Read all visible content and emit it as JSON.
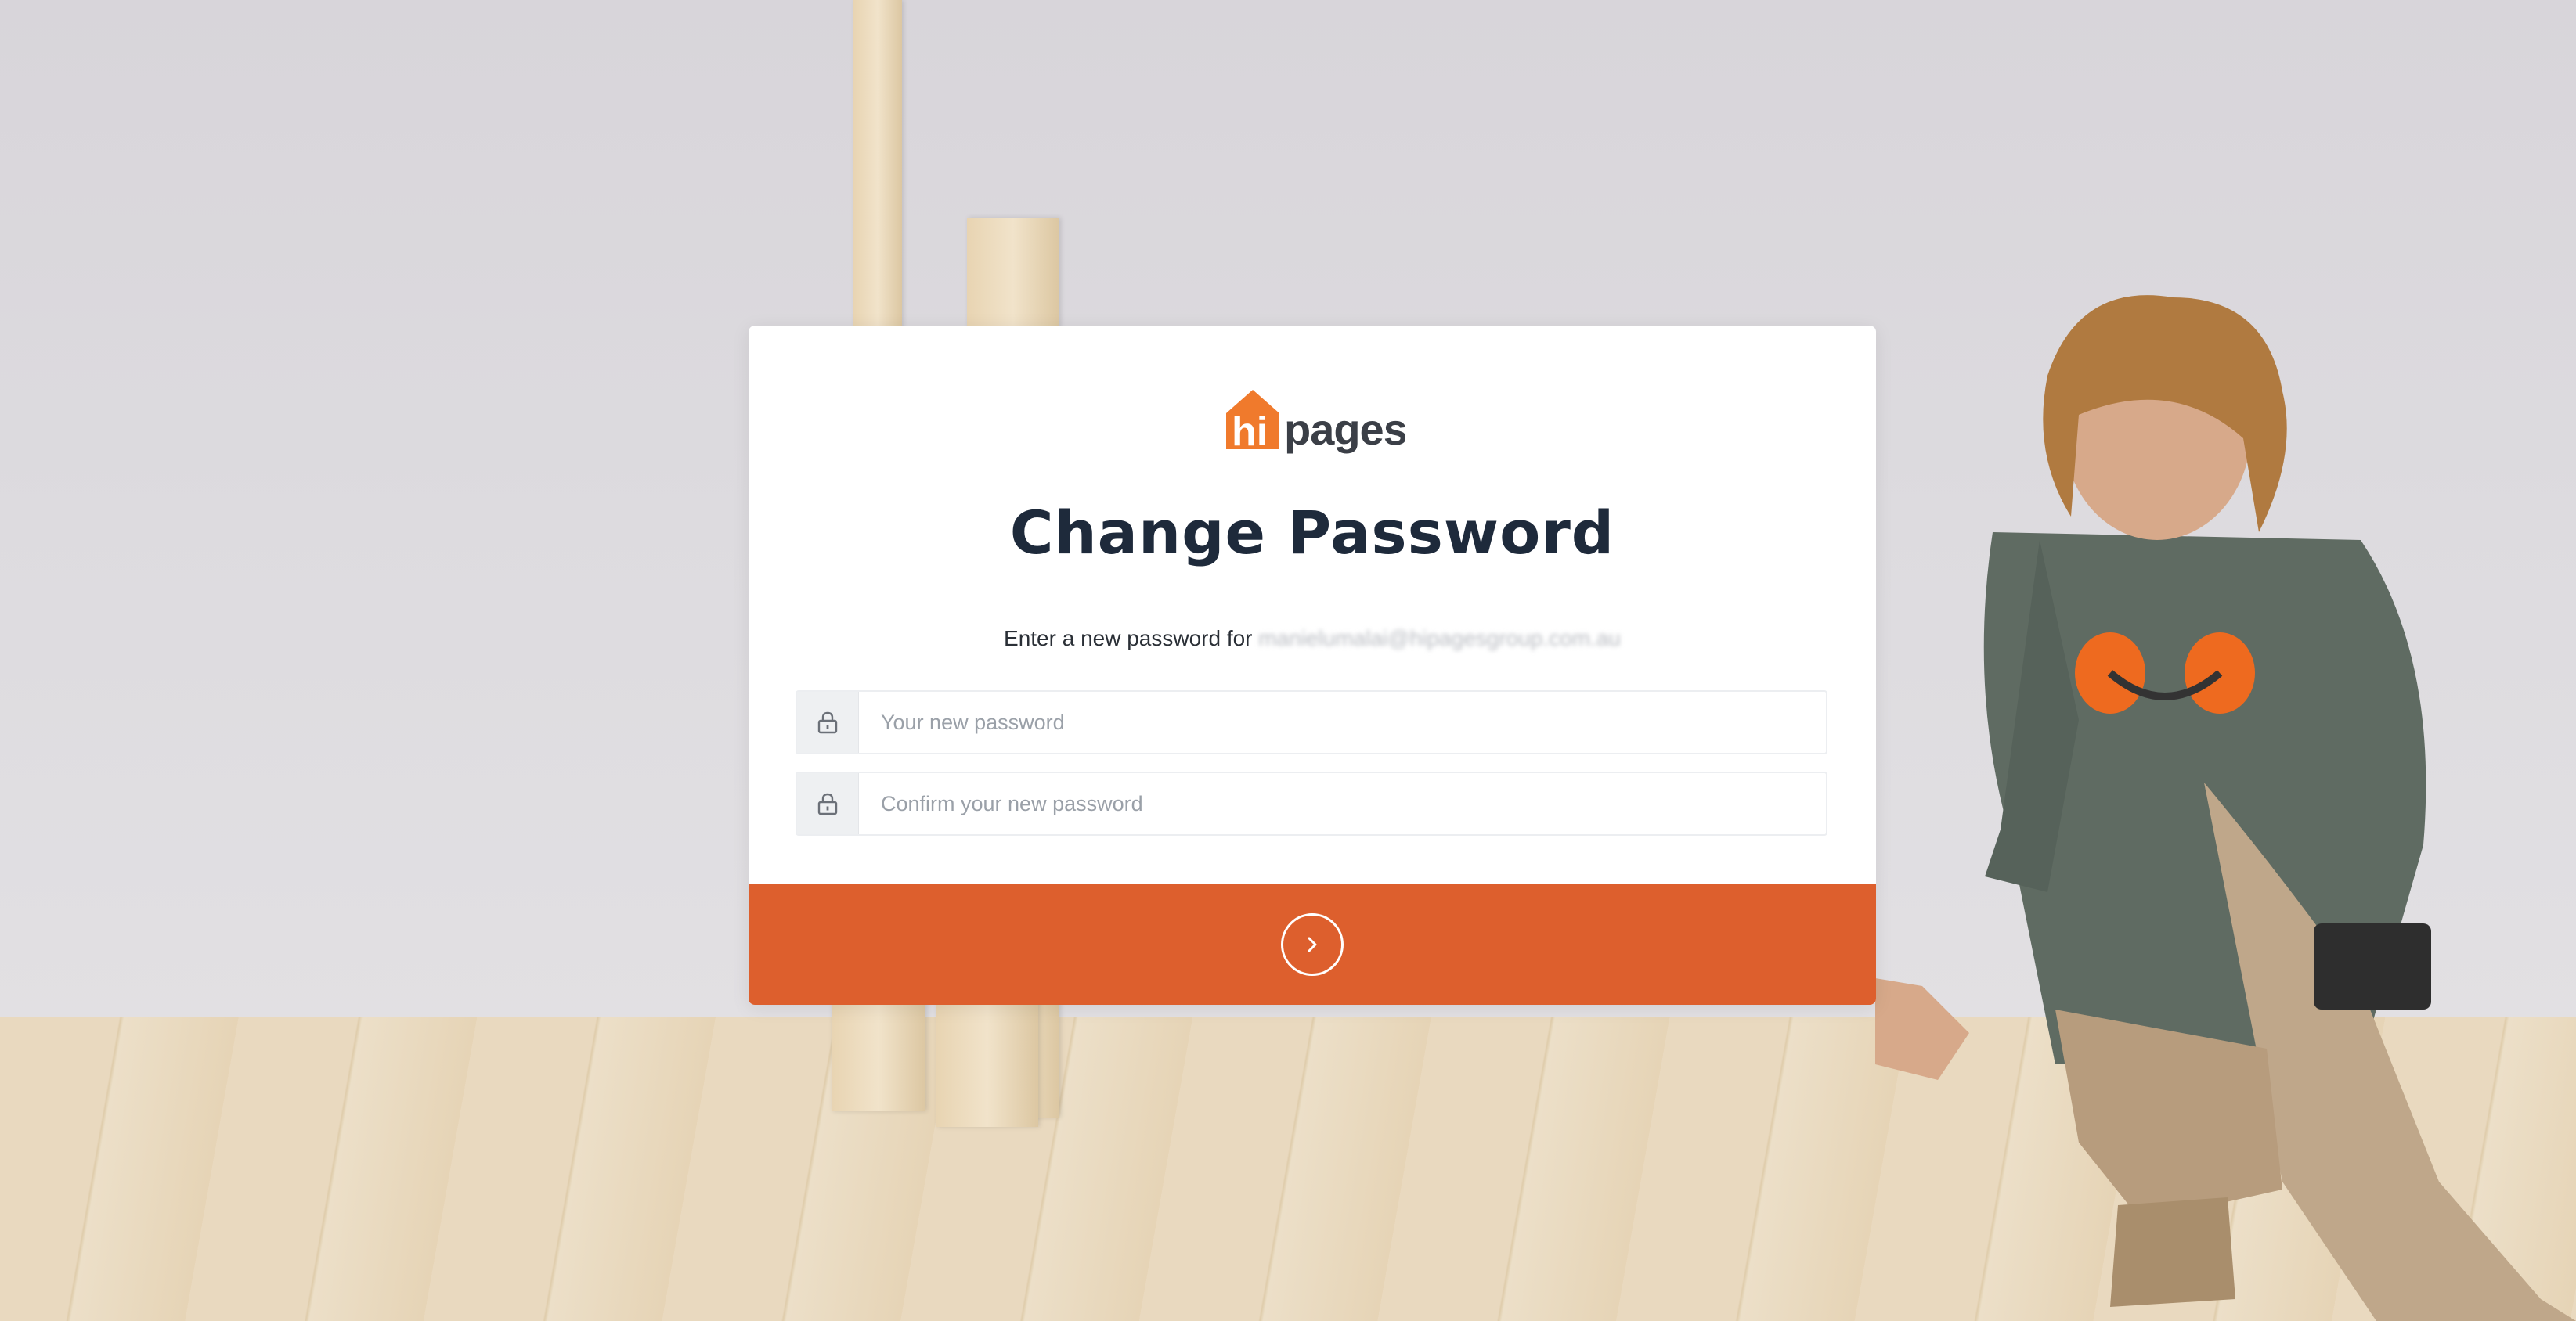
{
  "brand": {
    "logo_hi": "hi",
    "logo_pages": "pages",
    "accent_color": "#dd5f2d",
    "logo_orange": "#f07a2c"
  },
  "page": {
    "title": "Change Password",
    "subtitle_prefix": "Enter a new password for ",
    "email": "manielumalai@hipagesgroup.com.au"
  },
  "form": {
    "new_password": {
      "icon": "lock-icon",
      "placeholder": "Your new password",
      "value": ""
    },
    "confirm_password": {
      "icon": "lock-icon",
      "placeholder": "Confirm your new password",
      "value": ""
    },
    "submit": {
      "icon": "chevron-right-icon"
    }
  }
}
